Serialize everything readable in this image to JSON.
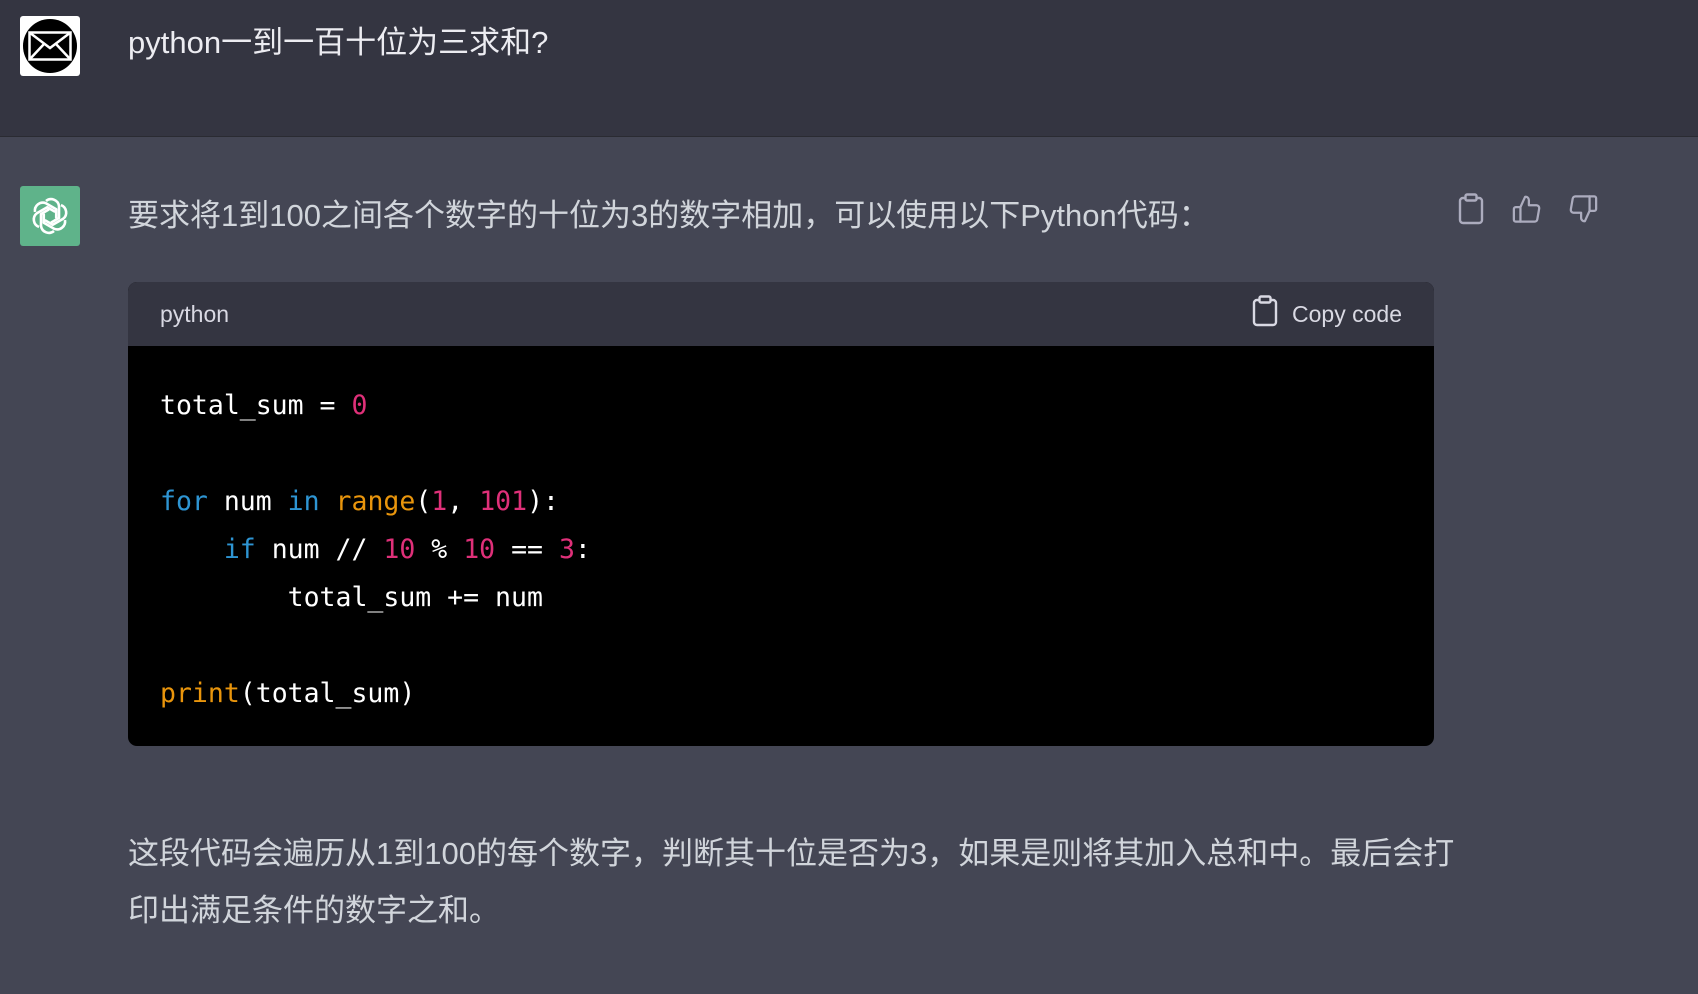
{
  "user_message": {
    "avatar_icon": "envelope-icon",
    "text": "python一到一百十位为三求和?"
  },
  "assistant_message": {
    "avatar_icon": "openai-logo-icon",
    "intro": "要求将1到100之间各个数字的十位为3的数字相加，可以使用以下Python代码：",
    "actions": {
      "copy_icon": "clipboard-icon",
      "like_icon": "thumbs-up-icon",
      "dislike_icon": "thumbs-down-icon"
    },
    "code_block": {
      "language": "python",
      "copy_label": "Copy code",
      "lines": [
        [
          {
            "t": "total_sum = ",
            "c": "plain"
          },
          {
            "t": "0",
            "c": "num"
          }
        ],
        [],
        [
          {
            "t": "for",
            "c": "kw"
          },
          {
            "t": " num ",
            "c": "plain"
          },
          {
            "t": "in",
            "c": "kw"
          },
          {
            "t": " ",
            "c": "plain"
          },
          {
            "t": "range",
            "c": "fn"
          },
          {
            "t": "(",
            "c": "plain"
          },
          {
            "t": "1",
            "c": "num"
          },
          {
            "t": ", ",
            "c": "plain"
          },
          {
            "t": "101",
            "c": "num"
          },
          {
            "t": "):",
            "c": "plain"
          }
        ],
        [
          {
            "t": "    ",
            "c": "plain"
          },
          {
            "t": "if",
            "c": "kw"
          },
          {
            "t": " num // ",
            "c": "plain"
          },
          {
            "t": "10",
            "c": "num"
          },
          {
            "t": " % ",
            "c": "plain"
          },
          {
            "t": "10",
            "c": "num"
          },
          {
            "t": " == ",
            "c": "plain"
          },
          {
            "t": "3",
            "c": "num"
          },
          {
            "t": ":",
            "c": "plain"
          }
        ],
        [
          {
            "t": "        total_sum += num",
            "c": "plain"
          }
        ],
        [],
        [
          {
            "t": "print",
            "c": "fn"
          },
          {
            "t": "(total_sum)",
            "c": "plain"
          }
        ]
      ]
    },
    "outro": "这段代码会遍历从1到100的每个数字，判断其十位是否为3，如果是则将其加入总和中。最后会打印出满足条件的数字之和。"
  },
  "colors": {
    "page_bg": "#444654",
    "user_row_bg": "#343541",
    "code_bg": "#000000",
    "code_header_bg": "#343541",
    "keyword": "#2e95d3",
    "function": "#e9950c",
    "number": "#df3079",
    "assistant_avatar": "#5fb38a"
  }
}
